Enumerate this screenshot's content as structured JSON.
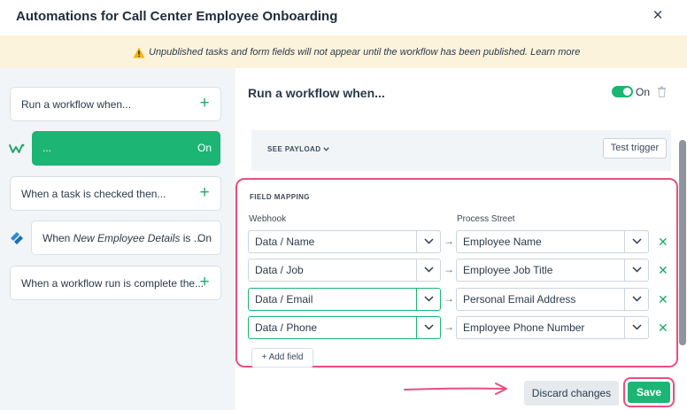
{
  "header": {
    "title": "Automations for Call Center Employee Onboarding",
    "close_icon": "×"
  },
  "banner": {
    "icon": "warning-icon",
    "text": "Unpublished tasks and form fields will not appear until the workflow has been published. Learn more"
  },
  "sidebar": {
    "cards": [
      {
        "label": "Run a workflow when...",
        "action": "+"
      },
      {
        "label": "...",
        "status": "On",
        "icon": "webhook-icon",
        "selected": true
      },
      {
        "label": "When a task is checked then...",
        "action": "+"
      },
      {
        "label_prefix": "When ",
        "label_em": "New Employee Details",
        "label_suffix": " is ...",
        "status": "On",
        "icon": "process-street-icon"
      },
      {
        "label": "When a workflow run is complete the...",
        "action": "+"
      }
    ]
  },
  "panel": {
    "title": "Run a workflow when...",
    "toggle_label": "On",
    "toggle_on": true,
    "see_payload": "SEE PAYLOAD",
    "test_trigger": "Test trigger",
    "field_mapping": {
      "label": "FIELD MAPPING",
      "col_left": "Webhook",
      "col_right": "Process Street",
      "rows": [
        {
          "source": "Data / Name",
          "target": "Employee Name",
          "highlighted": false
        },
        {
          "source": "Data / Job",
          "target": "Employee Job Title",
          "highlighted": false
        },
        {
          "source": "Data / Email",
          "target": "Personal Email Address",
          "highlighted": true
        },
        {
          "source": "Data / Phone",
          "target": "Employee Phone Number",
          "highlighted": true
        }
      ],
      "add_field": "Add field"
    }
  },
  "footer": {
    "discard": "Discard changes",
    "save": "Save"
  },
  "colors": {
    "accent_green": "#1cb574",
    "highlight_pink": "#e84f7f",
    "banner_bg": "#fcf3dc"
  }
}
